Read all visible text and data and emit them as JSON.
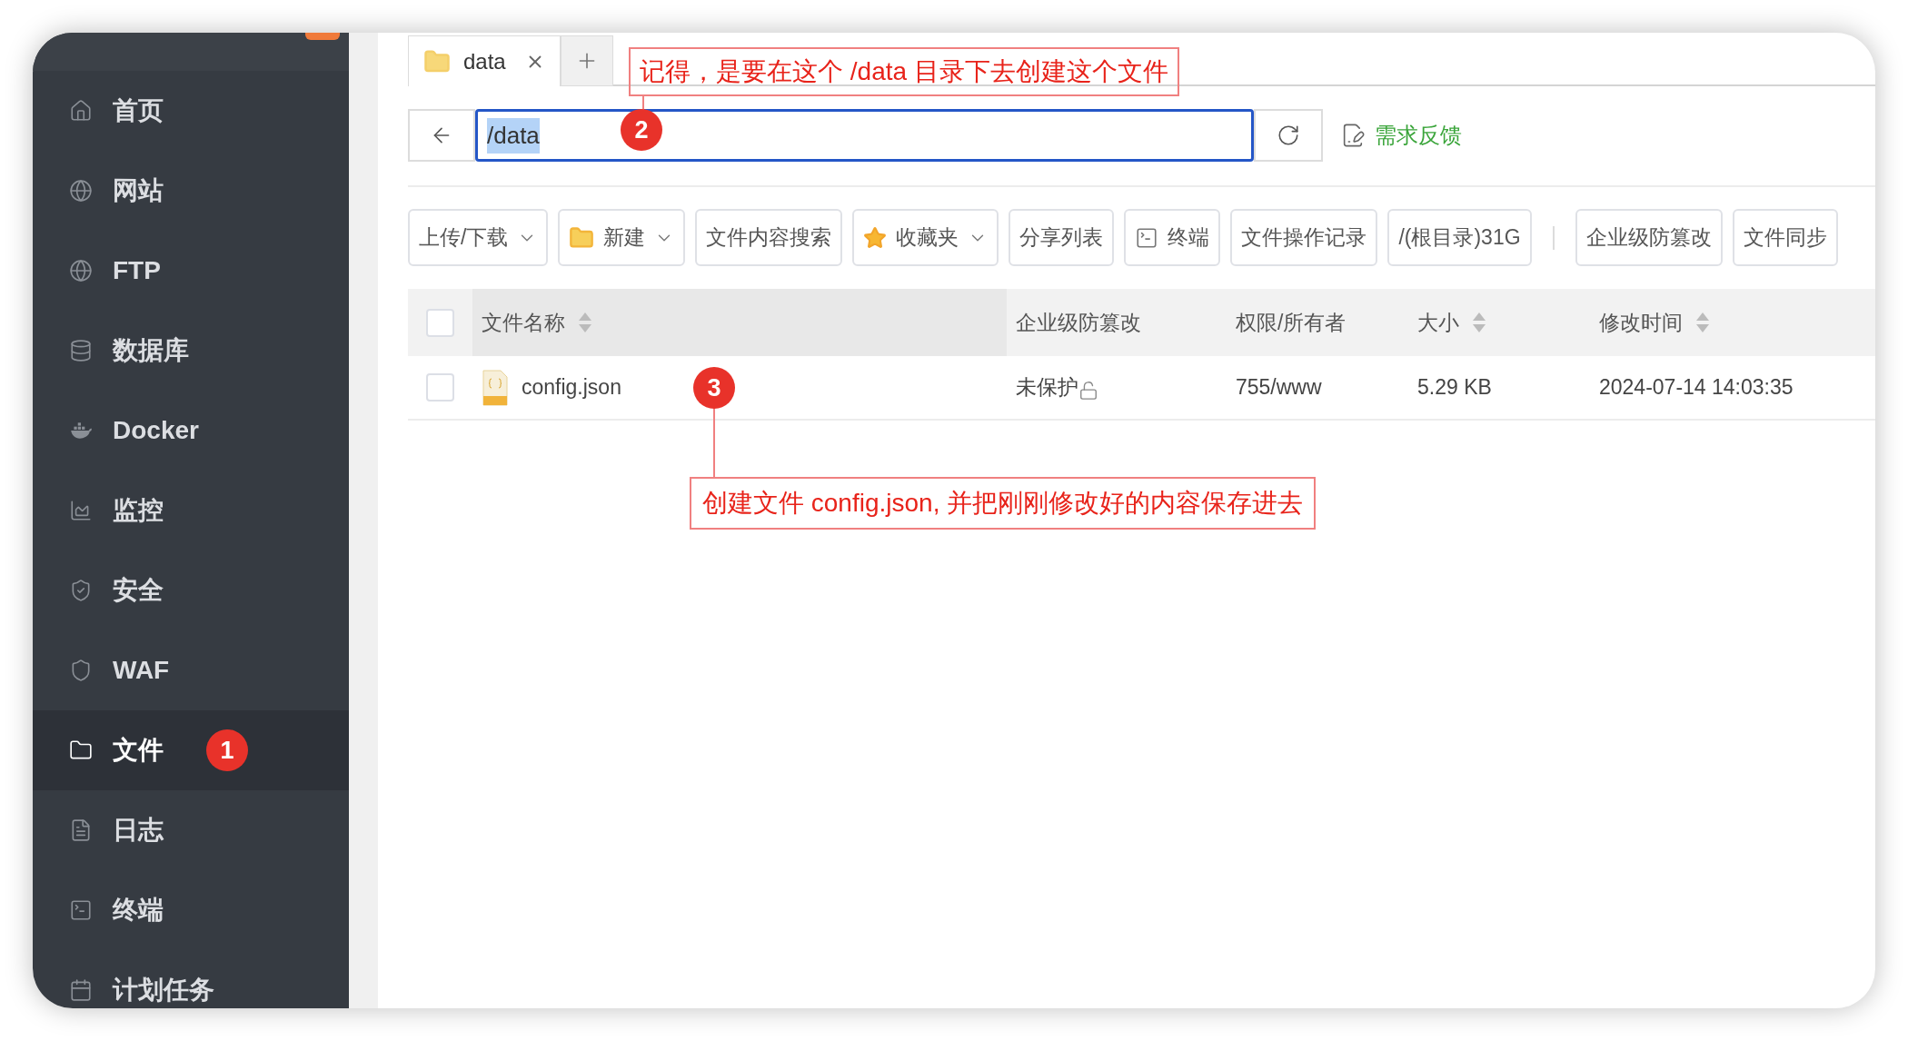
{
  "sidebar": {
    "items": [
      {
        "label": "首页",
        "kind": "home",
        "selected": false
      },
      {
        "label": "网站",
        "kind": "globe",
        "selected": false
      },
      {
        "label": "FTP",
        "kind": "globe",
        "selected": false
      },
      {
        "label": "数据库",
        "kind": "database",
        "selected": false
      },
      {
        "label": "Docker",
        "kind": "whale",
        "selected": false
      },
      {
        "label": "监控",
        "kind": "chart",
        "selected": false
      },
      {
        "label": "安全",
        "kind": "shield-check",
        "selected": false
      },
      {
        "label": "WAF",
        "kind": "shield",
        "selected": false
      },
      {
        "label": "文件",
        "kind": "folder",
        "selected": true
      },
      {
        "label": "日志",
        "kind": "document",
        "selected": false
      },
      {
        "label": "终端",
        "kind": "terminal",
        "selected": false
      },
      {
        "label": "计划任务",
        "kind": "calendar",
        "selected": false
      }
    ]
  },
  "tabs": [
    {
      "label": "data",
      "selected": true
    }
  ],
  "address": {
    "value": "/data",
    "highlighted": true
  },
  "feedback_link": "需求反馈",
  "toolbar": [
    {
      "label": "上传/下载",
      "kind": "plain",
      "dropdown": true
    },
    {
      "label": "新建",
      "kind": "folder-plus",
      "dropdown": true
    },
    {
      "label": "文件内容搜索",
      "kind": "plain",
      "dropdown": false
    },
    {
      "label": "收藏夹",
      "kind": "star",
      "dropdown": true
    },
    {
      "label": "分享列表",
      "kind": "plain",
      "dropdown": false
    },
    {
      "label": "终端",
      "kind": "terminal",
      "dropdown": false
    },
    {
      "label": "文件操作记录",
      "kind": "plain",
      "dropdown": false
    },
    {
      "label": "/(根目录)31G",
      "kind": "plain",
      "dropdown": false
    }
  ],
  "toolbar_extra": [
    {
      "label": "企业级防篡改"
    },
    {
      "label": "文件同步"
    }
  ],
  "table": {
    "select_all_checked": false,
    "columns": [
      {
        "label": "文件名称",
        "sortable": true
      },
      {
        "label": "企业级防篡改",
        "sortable": false
      },
      {
        "label": "权限/所有者",
        "sortable": false
      },
      {
        "label": "大小",
        "sortable": true
      },
      {
        "label": "修改时间",
        "sortable": true
      }
    ],
    "rows": [
      {
        "checked": false,
        "name": "config.json",
        "protection": "未保护",
        "permission": "755/www",
        "size": "5.29 KB",
        "modified": "2024-07-14 14:03:35"
      }
    ]
  },
  "annotations": {
    "badges": [
      "1",
      "2",
      "3"
    ],
    "notes": [
      "记得，是要在这个 /data 目录下去创建这个文件",
      "创建文件 config.json, 并把刚刚修改好的内容保存进去"
    ]
  }
}
